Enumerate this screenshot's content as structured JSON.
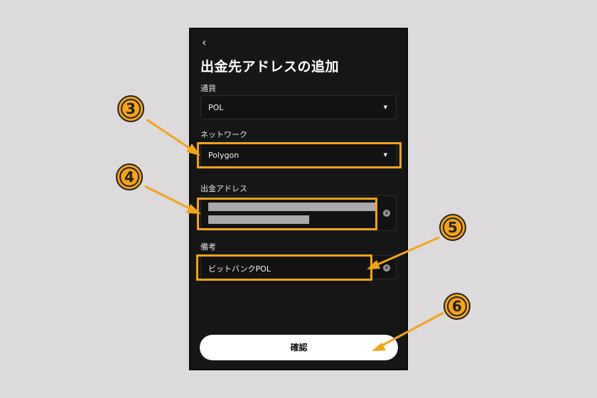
{
  "screen": {
    "back_icon": "‹",
    "title": "出金先アドレスの追加",
    "currency": {
      "label": "通貨",
      "value": "POL"
    },
    "network": {
      "label": "ネットワーク",
      "value": "Polygon"
    },
    "address": {
      "label": "出金アドレス"
    },
    "memo": {
      "label": "備考",
      "value": "ビットバンクPOL"
    },
    "confirm_label": "確認"
  },
  "annotations": [
    {
      "number": "3"
    },
    {
      "number": "4"
    },
    {
      "number": "5"
    },
    {
      "number": "6"
    }
  ],
  "colors": {
    "highlight": "#f5a415",
    "background": "#dcdadb",
    "panel": "#161616"
  },
  "icons": [
    "back-chevron-icon",
    "dropdown-caret-icon",
    "clear-icon"
  ]
}
